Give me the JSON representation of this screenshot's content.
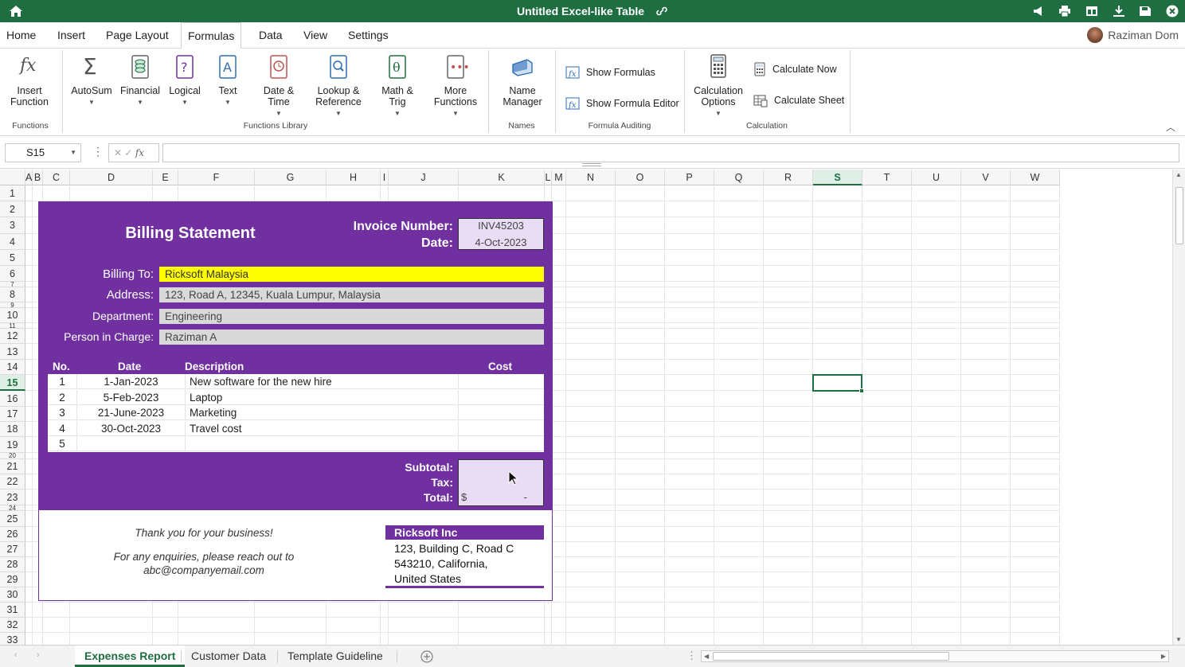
{
  "titlebar": {
    "title": "Untitled Excel-like Table"
  },
  "menu": {
    "items": [
      "Home",
      "Insert",
      "Page Layout",
      "Formulas",
      "Data",
      "View",
      "Settings"
    ],
    "active": "Formulas"
  },
  "user": {
    "name": "Raziman Dom"
  },
  "ribbon": {
    "insert_function": [
      "Insert",
      "Function"
    ],
    "autosum": "AutoSum",
    "financial": "Financial",
    "logical": "Logical",
    "text": "Text",
    "date_time": [
      "Date &",
      "Time"
    ],
    "lookup": [
      "Lookup &",
      "Reference"
    ],
    "math": "Math & Trig",
    "more": [
      "More",
      "Functions"
    ],
    "name_manager": [
      "Name",
      "Manager"
    ],
    "show_formulas": "Show Formulas",
    "show_formula_editor": "Show Formula Editor",
    "calc_options": [
      "Calculation",
      "Options"
    ],
    "calc_now": "Calculate Now",
    "calc_sheet": "Calculate Sheet",
    "groups": {
      "functions": "Functions",
      "library": "Functions Library",
      "names": "Names",
      "auditing": "Formula Auditing",
      "calculation": "Calculation"
    }
  },
  "formula_bar": {
    "cell_ref": "S15",
    "fx": "fx",
    "value": ""
  },
  "columns": [
    {
      "label": "A",
      "w": 0
    },
    {
      "label": "B",
      "w": 0
    },
    {
      "label": "C"
    },
    {
      "label": "D"
    },
    {
      "label": "E"
    },
    {
      "label": "F"
    },
    {
      "label": "G"
    },
    {
      "label": "H"
    },
    {
      "label": "I"
    },
    {
      "label": "J"
    },
    {
      "label": "K"
    },
    {
      "label": "L"
    },
    {
      "label": "M"
    },
    {
      "label": "N"
    },
    {
      "label": "O"
    },
    {
      "label": "P"
    },
    {
      "label": "Q"
    },
    {
      "label": "R"
    },
    {
      "label": "S"
    },
    {
      "label": "T"
    },
    {
      "label": "U"
    },
    {
      "label": "V"
    },
    {
      "label": "W"
    }
  ],
  "rows": [
    "1",
    "2",
    "3",
    "4",
    "5",
    "6",
    "7",
    "8",
    "9",
    "10",
    "11",
    "12",
    "13",
    "14",
    "15",
    "16",
    "17",
    "18",
    "19",
    "20",
    "21",
    "22",
    "23",
    "24",
    "25",
    "26",
    "27",
    "28",
    "29",
    "30",
    "31",
    "32",
    "33"
  ],
  "selected": {
    "col": "S",
    "row": "15"
  },
  "invoice": {
    "title": "Billing Statement",
    "invoice_label": "Invoice Number:",
    "invoice_value": "INV45203",
    "date_label": "Date:",
    "date_value": "4-Oct-2023",
    "billing_label": "Billing To:",
    "billing_value": "Ricksoft Malaysia",
    "address_label": "Address:",
    "address_value": "123, Road A, 12345, Kuala Lumpur, Malaysia",
    "dept_label": "Department:",
    "dept_value": "Engineering",
    "person_label": "Person in Charge:",
    "person_value": "Raziman A",
    "table_headers": {
      "no": "No.",
      "date": "Date",
      "desc": "Description",
      "cost": "Cost"
    },
    "items": [
      {
        "no": "1",
        "date": "1-Jan-2023",
        "desc": "New software for the new hire",
        "cost": ""
      },
      {
        "no": "2",
        "date": "5-Feb-2023",
        "desc": "Laptop",
        "cost": ""
      },
      {
        "no": "3",
        "date": "21-June-2023",
        "desc": "Marketing",
        "cost": ""
      },
      {
        "no": "4",
        "date": "30-Oct-2023",
        "desc": "Travel cost",
        "cost": ""
      },
      {
        "no": "5",
        "date": "",
        "desc": "",
        "cost": ""
      }
    ],
    "subtotal_label": "Subtotal:",
    "tax_label": "Tax:",
    "total_label": "Total:",
    "total_currency": "$",
    "total_value": "-",
    "thanks": "Thank you for your business!",
    "enquiries_1": "For any enquiries, please reach out to",
    "enquiries_2": "abc@companyemail.com",
    "company_name": "Ricksoft Inc",
    "company_addr_1": "123, Building C, Road C",
    "company_addr_2": "543210, California,",
    "company_addr_3": "United States"
  },
  "sheet_tabs": [
    "Expenses Report",
    "Customer Data",
    "Template Guideline"
  ],
  "active_tab": "Expenses Report",
  "colors": {
    "accent": "#1e6e41",
    "invoice": "#7030a0",
    "highlight": "#ffff00"
  }
}
